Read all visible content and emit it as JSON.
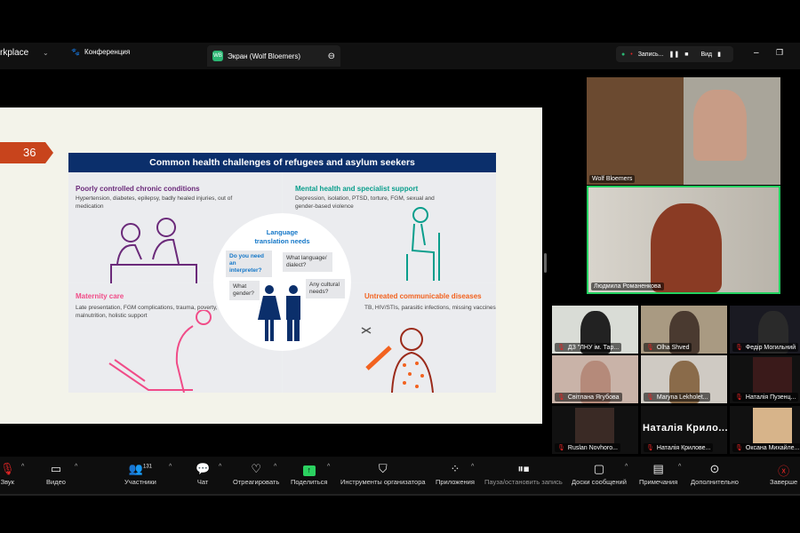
{
  "topbar": {
    "brand": "rkplace",
    "meeting_tab": "Конференция",
    "share_tab": "Экран (Wolf Bloemers)",
    "share_initials": "WB",
    "record_label": "Запись...",
    "view_label": "Вид"
  },
  "slide": {
    "number": "36",
    "title": "Common health challenges of refugees and asylum seekers",
    "quadrants": [
      {
        "title": "Poorly controlled chronic conditions",
        "desc": "Hypertension, diabetes, epilepsy, badly healed injuries, out of medication",
        "color": "#6b2a7a"
      },
      {
        "title": "Mental health and specialist support",
        "desc": "Depression, isolation, PTSD, torture, FGM, sexual and gender-based violence",
        "color": "#0a9e8c"
      },
      {
        "title": "Maternity care",
        "desc": "Late presentation, FGM complications, trauma, poverty, malnutrition, holistic support",
        "color": "#f04c88"
      },
      {
        "title": "Untreated communicable diseases",
        "desc": "TB, HIV/STIs, parasitic infections, missing vaccines",
        "color": "#f2621f"
      }
    ],
    "center": {
      "title": "Language translation needs",
      "bubbles": [
        "Do you need an interpreter?",
        "What language/ dialect?",
        "What gender?",
        "Any cultural needs?"
      ]
    }
  },
  "speakers": [
    {
      "name": "Wolf Bloemers"
    },
    {
      "name": "Людмила Романенкова"
    }
  ],
  "gallery": [
    "ДЗ \"ЛНУ ім. Тар...",
    "Olha Shved",
    "Федір Могильний",
    "Світлана Ягубова",
    "Maryna Lekholet...",
    "Наталія Пузенц...",
    "Ruslan Novhoro...",
    "Наталія Крилове...",
    "Оксана Михайле..."
  ],
  "gallery_big_name": "Наталія Крило...",
  "toolbar": {
    "audio": "Звук",
    "video": "Видео",
    "participants": "Участники",
    "participants_count": "131",
    "chat": "Чат",
    "react": "Отреагировать",
    "share": "Поделиться",
    "host_tools": "Инструменты организатора",
    "apps": "Приложения",
    "pause_record": "Пауза/остановить запись",
    "whiteboards": "Доски сообщений",
    "notes": "Примечания",
    "more": "Дополнительно",
    "end": "Заверше"
  }
}
